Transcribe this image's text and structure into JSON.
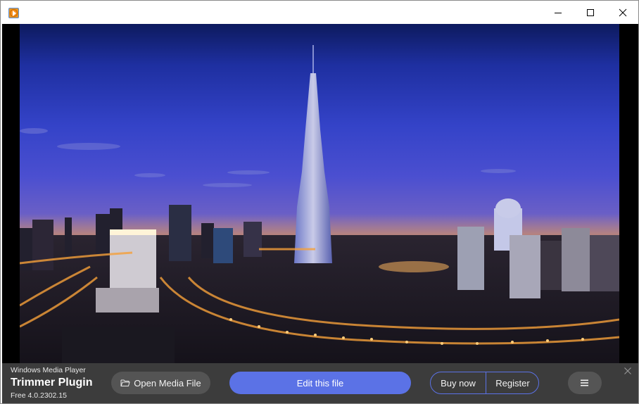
{
  "window": {
    "icon": "media-player-play-icon",
    "controls": {
      "minimize": "minimize-icon",
      "maximize": "maximize-icon",
      "close": "close-icon"
    }
  },
  "video": {
    "description": "Night skyline of Dubai with Burj Khalifa under a blue-purple dusk sky",
    "colors": {
      "sky_top": "#0d1a5e",
      "sky_mid": "#3443c8",
      "horizon": "#8a6aa8",
      "city_lights": "#f5a03a"
    }
  },
  "bottombar": {
    "brand_top": "Windows Media Player",
    "brand_title": "Trimmer Plugin",
    "brand_version": "Free 4.0.2302.15",
    "open_button": {
      "label": "Open Media File",
      "icon": "folder-open-icon"
    },
    "edit_button": {
      "label": "Edit this file"
    },
    "buy_button": {
      "label": "Buy now"
    },
    "register_button": {
      "label": "Register"
    },
    "menu_button": {
      "icon": "hamburger-menu-icon"
    },
    "dismiss_button": {
      "icon": "close-icon"
    },
    "colors": {
      "background": "#3c3c3c",
      "accent": "#5b72e6",
      "secondary_button": "#545454"
    }
  }
}
